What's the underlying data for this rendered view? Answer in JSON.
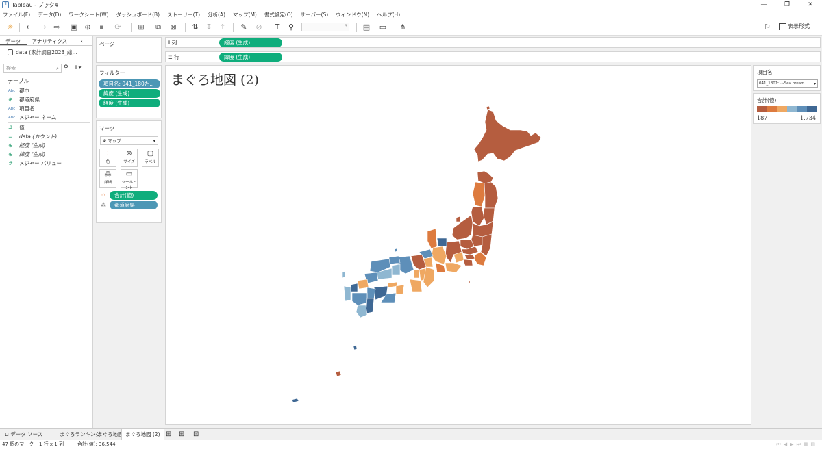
{
  "window": {
    "title": "Tableau - ブック4",
    "min": "—",
    "restore": "❐",
    "close": "✕"
  },
  "menu": [
    "ファイル(F)",
    "データ(D)",
    "ワークシート(W)",
    "ダッシュボード(B)",
    "ストーリー(T)",
    "分析(A)",
    "マップ(M)",
    "書式設定(O)",
    "サーバー(S)",
    "ウィンドウ(N)",
    "ヘルプ(H)"
  ],
  "toolbar": {
    "show_me": "表示形式"
  },
  "data_pane": {
    "tab_data": "データ",
    "tab_analytics": "アナリティクス",
    "datasource": "data (家計調査2023_総…",
    "search_placeholder": "検索",
    "tables_header": "テーブル",
    "dimensions": [
      {
        "type": "Abc",
        "name": "都市"
      },
      {
        "type": "globe",
        "name": "都道府県"
      },
      {
        "type": "Abc",
        "name": "項目名"
      },
      {
        "type": "Abc",
        "name": "メジャー ネーム"
      }
    ],
    "measures": [
      {
        "type": "#",
        "name": "値"
      },
      {
        "type": "=#",
        "name": "data (カウント)"
      },
      {
        "type": "globe",
        "name": "経度 (生成)"
      },
      {
        "type": "globe",
        "name": "緯度 (生成)"
      },
      {
        "type": "#",
        "name": "メジャー バリュー"
      }
    ]
  },
  "shelves": {
    "pages": "ページ",
    "columns_label": "列",
    "columns_pill": "経度 (生成)",
    "rows_label": "行",
    "rows_pill": "緯度 (生成)",
    "filters_label": "フィルター",
    "filters": [
      "項目名: 041_180た..",
      "緯度 (生成)",
      "経度 (生成)"
    ]
  },
  "marks": {
    "header": "マーク",
    "type": "マップ",
    "buttons": {
      "color": "色",
      "size": "サイズ",
      "label": "ラベル",
      "detail": "詳細",
      "tooltip": "ツールヒント"
    },
    "pills": [
      "合計(値)",
      "都道府県"
    ]
  },
  "view": {
    "title": "まぐろ地図 (2)"
  },
  "legend_filter": {
    "title": "項目名",
    "selected": "041_180たい-Sea bream"
  },
  "color_legend": {
    "title": "合計(値)",
    "min": "187",
    "max": "1,734",
    "colors": [
      "#b55d3f",
      "#dd7b3f",
      "#efa862",
      "#8fb7d1",
      "#5e8fb9",
      "#3f6894"
    ]
  },
  "sheet_tabs": [
    "データ ソース",
    "まぐろランキング",
    "まぐろ地図",
    "まぐろ地図 (2)"
  ],
  "status": {
    "marks": "47 個のマーク",
    "rows_cols": "1 行 x 1 列",
    "sum": "合計(値): 36,544"
  }
}
